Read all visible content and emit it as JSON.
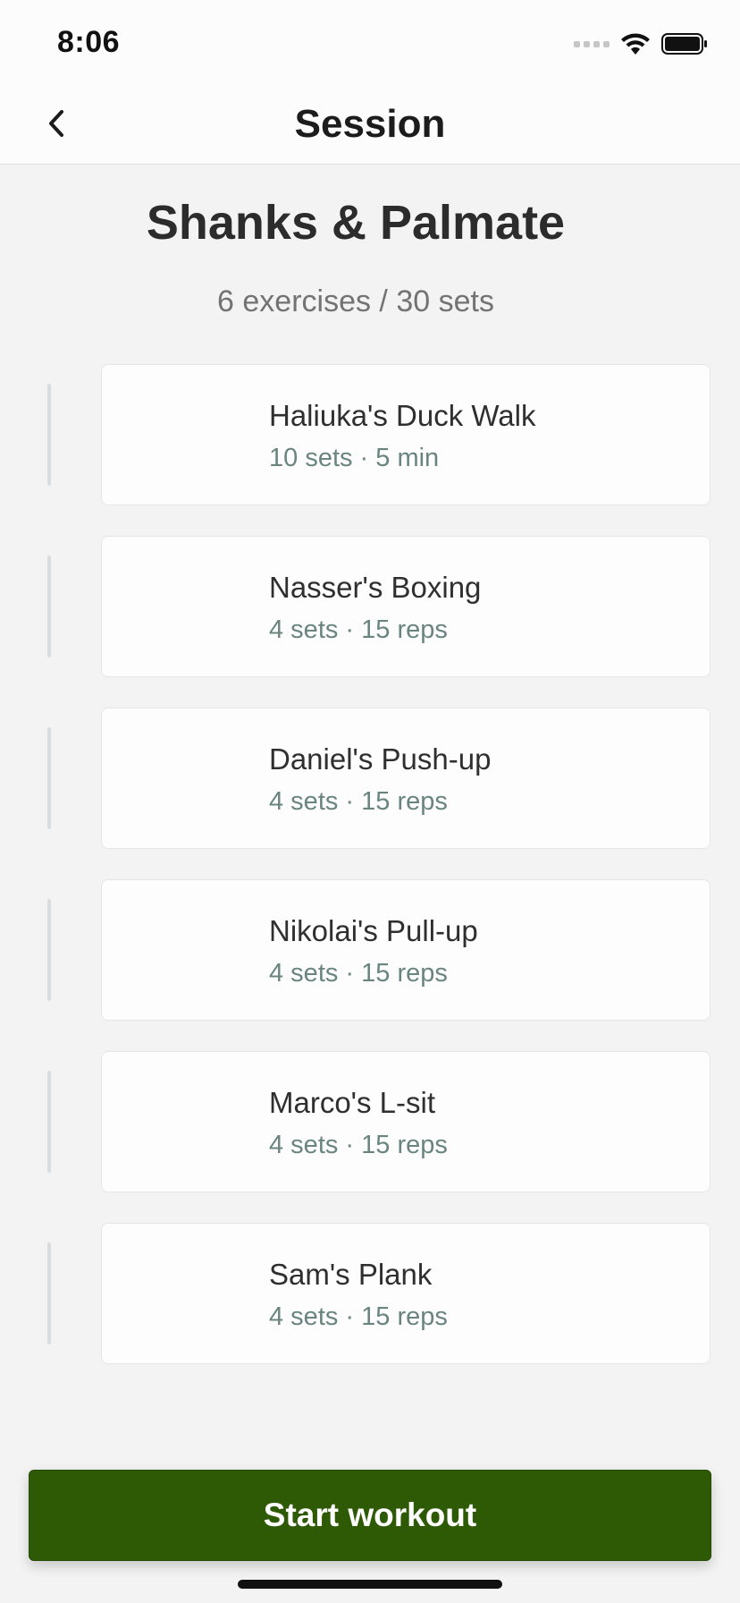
{
  "status_bar": {
    "time": "8:06",
    "icons": [
      "cellular-signal-icon",
      "wifi-icon",
      "battery-icon"
    ]
  },
  "nav": {
    "title": "Session",
    "back_icon": "chevron-left-icon"
  },
  "session": {
    "title": "Shanks & Palmate",
    "summary": "6 exercises / 30 sets"
  },
  "exercises": [
    {
      "name": "Haliuka's Duck Walk",
      "detail": "10 sets · 5 min"
    },
    {
      "name": "Nasser's Boxing",
      "detail": "4 sets · 15 reps"
    },
    {
      "name": "Daniel's Push-up",
      "detail": "4 sets · 15 reps"
    },
    {
      "name": "Nikolai's Pull-up",
      "detail": "4 sets · 15 reps"
    },
    {
      "name": "Marco's L-sit",
      "detail": "4 sets · 15 reps"
    },
    {
      "name": "Sam's Plank",
      "detail": "4 sets · 15 reps"
    }
  ],
  "actions": {
    "start_label": "Start workout"
  },
  "colors": {
    "accent": "#2e5a06",
    "background": "#f3f3f3",
    "detail_text": "#6a8580"
  }
}
